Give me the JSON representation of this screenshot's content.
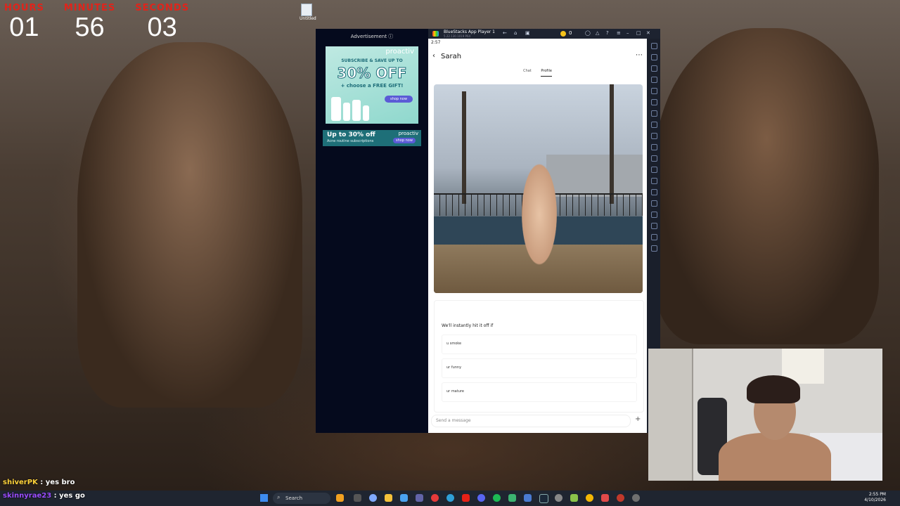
{
  "timer": {
    "hours_label": "HOURS",
    "hours": "01",
    "minutes_label": "MINUTES",
    "minutes": "56",
    "seconds_label": "SECONDS",
    "seconds": "03"
  },
  "desktop": {
    "icon_label": "Untitled"
  },
  "ad": {
    "header": "Advertisement ⓘ",
    "banner1": {
      "brand": "proactiv",
      "line1": "SUBSCRIBE & SAVE UP TO",
      "headline": "30% OFF",
      "gift": "+ choose a FREE GIFT!",
      "cta": "shop now"
    },
    "banner2": {
      "brand": "proactiv",
      "headline": "Up to 30% off",
      "subtitle": "Acne routine subscriptions",
      "cta": "shop now"
    }
  },
  "bluestacks": {
    "title": "BlueStacks App Player 1",
    "subtitle": "5.22.130.1019 P64",
    "coins": "0",
    "status_time": "2:57"
  },
  "app": {
    "contact_name": "Sarah",
    "tabs": [
      {
        "label": "Chat"
      },
      {
        "label": "Profile"
      }
    ],
    "prompt_title": "We'll instantly hit it off if",
    "options": [
      "u smoke",
      "ur funny",
      "ur mature"
    ],
    "message_placeholder": "Send a message"
  },
  "chat_overlay": [
    {
      "user": "shiverPK",
      "text": " : yes bro"
    },
    {
      "user": "skinnyrae23",
      "text": " : yes go"
    }
  ],
  "taskbar": {
    "search_placeholder": "Search",
    "time": "2:55 PM",
    "date": "4/10/2026"
  },
  "colors": {
    "timer_label": "#e0241b",
    "accent": "#5b5bd6",
    "taskbar": "#1f2530"
  }
}
